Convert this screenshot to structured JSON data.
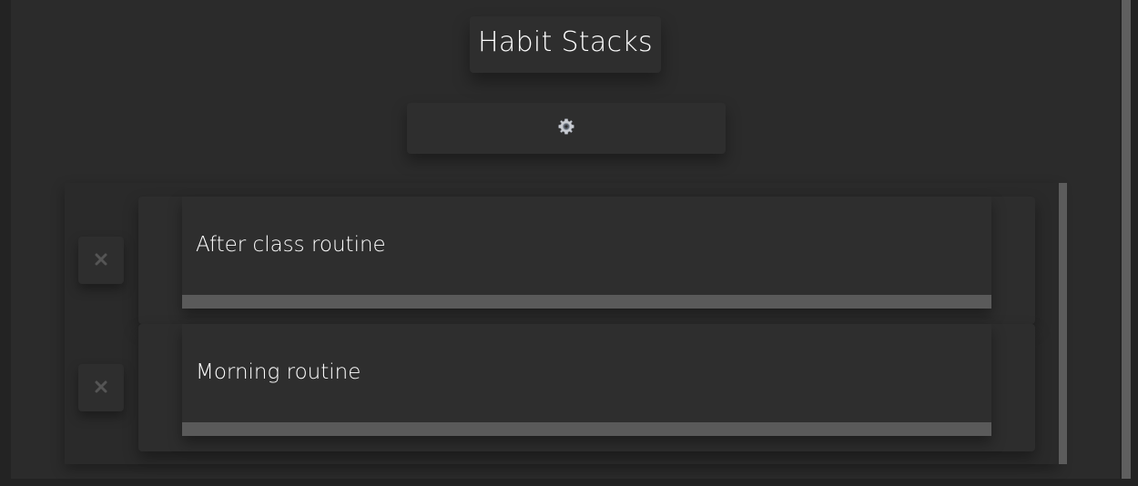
{
  "app": {
    "title": "Habit Stacks"
  },
  "toolbar": {
    "settings_icon": "gear-icon"
  },
  "stacks": [
    {
      "name": "After class routine",
      "delete_icon": "close-icon",
      "progress": 0
    },
    {
      "name": "Morning routine",
      "delete_icon": "close-icon",
      "progress": 0
    }
  ],
  "colors": {
    "background": "#232323",
    "surface": "#2b2b2b",
    "card": "#2e2e2e",
    "text": "#ffffff",
    "track": "#5a5a5a",
    "icon_muted": "#555555"
  }
}
